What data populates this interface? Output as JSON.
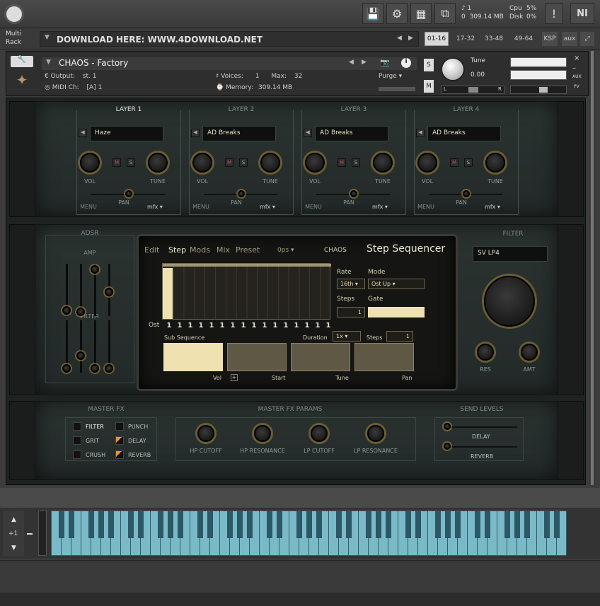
{
  "toolbar": {
    "cpu_label": "Cpu",
    "cpu_value": "5%",
    "disk_label": "Disk",
    "disk_value": "0%",
    "voices": "1",
    "midi": "0",
    "memory": "309.14 MB",
    "logo": "NI"
  },
  "rack": {
    "label_line1": "Multi",
    "label_line2": "Rack",
    "banner": "DOWNLOAD HERE: WWW.4DOWNLOAD.NET",
    "tabs": [
      "01-16",
      "17-32",
      "33-48",
      "49-64",
      "KSP",
      "aux"
    ]
  },
  "instrument": {
    "name": "CHAOS - Factory",
    "output_label": "Output:",
    "output_value": "st. 1",
    "midi_label": "MIDI Ch:",
    "midi_value": "[A]  1",
    "voices_label": "Voices:",
    "voices_value": "1",
    "max_label": "Max:",
    "max_value": "32",
    "memory_label": "Memory:",
    "memory_value": "309.14 MB",
    "purge": "Purge",
    "tune_label": "Tune",
    "tune_value": "0.00",
    "s": "S",
    "m": "M",
    "l": "L",
    "r": "R",
    "aux": "AUX",
    "pv": "PV"
  },
  "layers": [
    {
      "title": "LAYER 1",
      "preset": "Haze",
      "vol": "VOL",
      "tune": "TUNE",
      "menu": "MENU",
      "pan": "PAN",
      "mfx": "mfx"
    },
    {
      "title": "LAYER 2",
      "preset": "AD Breaks",
      "vol": "VOL",
      "tune": "TUNE",
      "menu": "MENU",
      "pan": "PAN",
      "mfx": "mfx"
    },
    {
      "title": "LAYER 3",
      "preset": "AD Breaks",
      "vol": "VOL",
      "tune": "TUNE",
      "menu": "MENU",
      "pan": "PAN",
      "mfx": "mfx"
    },
    {
      "title": "LAYER 4",
      "preset": "AD Breaks",
      "vol": "VOL",
      "tune": "TUNE",
      "menu": "MENU",
      "pan": "PAN",
      "mfx": "mfx"
    }
  ],
  "adsr": {
    "title": "ADSR",
    "amp": "AMP",
    "filter": "FILTER"
  },
  "sequencer": {
    "tabs": [
      "Edit",
      "Step",
      "Mods",
      "Mix",
      "Preset"
    ],
    "ops": "0ps",
    "chaos": "CHAOS",
    "title": "Step Sequencer",
    "rate_label": "Rate",
    "rate_value": "16th",
    "mode_label": "Mode",
    "mode_value": "Ost Up",
    "steps_label": "Steps",
    "steps_value": "1",
    "gate_label": "Gate",
    "ost_label": "Ost",
    "step_values": [
      "1",
      "1",
      "1",
      "1",
      "1",
      "1",
      "1",
      "1",
      "1",
      "1",
      "1",
      "1",
      "1",
      "1",
      "1",
      "1"
    ],
    "sub_label": "Sub Sequence",
    "duration_label": "Duration",
    "duration_value": "1x",
    "sub_steps_label": "Steps",
    "sub_steps_value": "1",
    "sub_tabs": [
      "Vol",
      "Start",
      "Tune",
      "Pan"
    ]
  },
  "filter": {
    "title": "FILTER",
    "type": "SV LP4",
    "res": "RES",
    "amt": "AMT"
  },
  "master_fx": {
    "title": "MASTER FX",
    "buttons": [
      "FILTER",
      "PUNCH",
      "GRIT",
      "DELAY",
      "CRUSH",
      "REVERB"
    ]
  },
  "fx_params": {
    "title": "MASTER FX PARAMS",
    "knobs": [
      "HP CUTOFF",
      "HP RESONANCE",
      "LP CUTOFF",
      "LP RESONANCE"
    ]
  },
  "send": {
    "title": "SEND LEVELS",
    "delay": "DELAY",
    "reverb": "REVERB"
  },
  "keyboard": {
    "octave": "+1"
  }
}
